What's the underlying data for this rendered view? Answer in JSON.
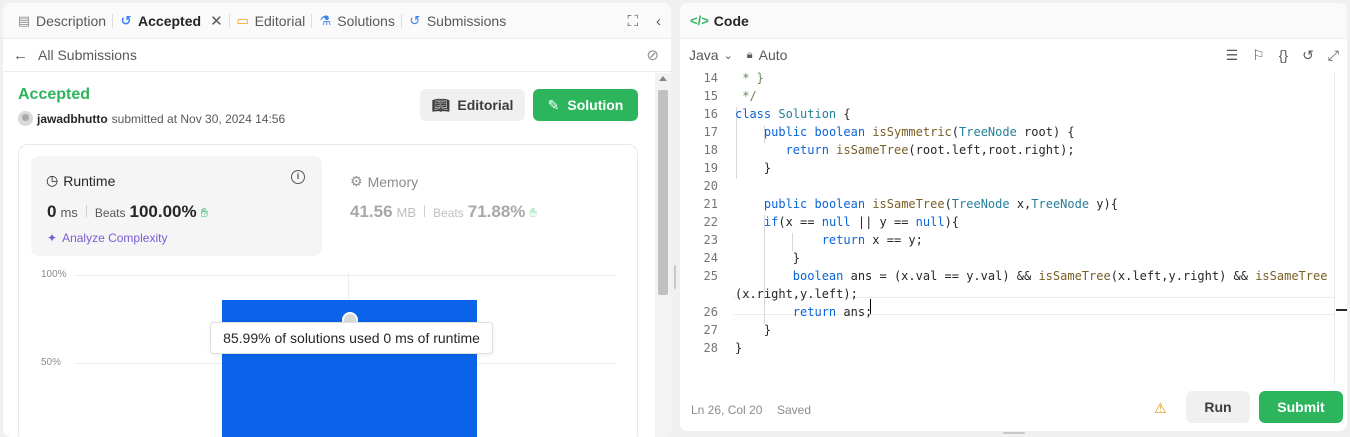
{
  "left_tabs": [
    {
      "label": "Description",
      "icon": "description-icon"
    },
    {
      "label": "Accepted",
      "icon": "history-icon",
      "active": true
    },
    {
      "label": "Editorial",
      "icon": "book-icon"
    },
    {
      "label": "Solutions",
      "icon": "flask-icon"
    },
    {
      "label": "Submissions",
      "icon": "history-icon"
    }
  ],
  "subbar": {
    "back_label": "All Submissions"
  },
  "submission": {
    "status": "Accepted",
    "user": "jawadbhutto",
    "submitted_text": "submitted at Nov 30, 2024 14:56",
    "editorial_label": "Editorial",
    "solution_label": "Solution"
  },
  "runtime": {
    "title": "Runtime",
    "value": "0",
    "unit": "ms",
    "beats_label": "Beats",
    "beats": "100.00%",
    "analyze_label": "Analyze Complexity"
  },
  "memory": {
    "title": "Memory",
    "value": "41.56",
    "unit": "MB",
    "beats_label": "Beats",
    "beats": "71.88%"
  },
  "chart_data": {
    "type": "bar",
    "y_ticks": [
      "100%",
      "50%"
    ],
    "categories": [
      "0 ms"
    ],
    "values": [
      85.99
    ],
    "tooltip": "85.99% of solutions used 0 ms of runtime"
  },
  "code_panel": {
    "title": "Code",
    "language": "Java",
    "mode": "Auto"
  },
  "code": {
    "line_numbers": [
      "14",
      "15",
      "16",
      "17",
      "18",
      "19",
      "20",
      "21",
      "22",
      "23",
      "24",
      "25",
      "",
      "26",
      "27",
      "28"
    ],
    "lines": [
      " * }",
      " */",
      "class Solution {",
      "    public boolean isSymmetric(TreeNode root) {",
      "       return isSameTree(root.left,root.right);",
      "    }",
      "",
      "    public boolean isSameTree(TreeNode x,TreeNode y){",
      "    if(x == null || y == null){",
      "            return x == y;",
      "        }",
      "        boolean ans = (x.val == y.val) && isSameTree(x.left,y.right) && isSameTree",
      "(x.right,y.left);",
      "        return ans;",
      "    }",
      "}"
    ]
  },
  "footer": {
    "position": "Ln 26, Col 20",
    "saved": "Saved",
    "run_label": "Run",
    "submit_label": "Submit"
  },
  "colors": {
    "accent_green": "#2db55d",
    "bar_blue": "#0a63e8",
    "analyze_purple": "#7c5cd6"
  }
}
